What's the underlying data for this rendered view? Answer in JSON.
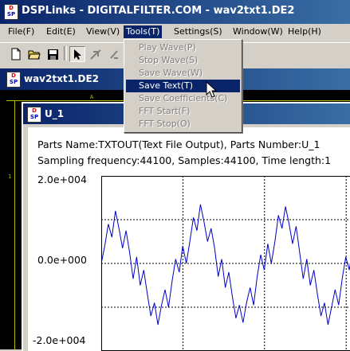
{
  "app": {
    "title": "DSPLinks - DIGITALFILTER.COM - wav2txt1.DE2",
    "icon_top": "D",
    "icon_bottom": "SP"
  },
  "menubar": {
    "items": [
      {
        "label": "File(F)",
        "active": false
      },
      {
        "label": "Edit(E)",
        "active": false
      },
      {
        "label": "View(V)",
        "active": false
      },
      {
        "label": "Tools(T)",
        "active": true
      },
      {
        "label": "Settings(S)",
        "active": false
      },
      {
        "label": "Window(W)",
        "active": false
      },
      {
        "label": "Help(H)",
        "active": false
      }
    ]
  },
  "toolbar": {
    "buttons": [
      "new-file-icon",
      "open-folder-icon",
      "save-disk-icon",
      "select-arrow-icon",
      "wire-tool-icon",
      "zoom-tool-icon"
    ]
  },
  "tools_menu": {
    "items": [
      {
        "label": "Play Wave(P)",
        "state": "disabled"
      },
      {
        "label": "Stop Wave(S)",
        "state": "disabled"
      },
      {
        "label": "Save Wave(W)",
        "state": "disabled"
      },
      {
        "label": "Save Text(T)",
        "state": "selected"
      },
      {
        "label": "Save Coefficients(C)",
        "state": "disabled"
      },
      {
        "label": "FFT Start(F)",
        "state": "disabled"
      },
      {
        "label": "FFT Stop(O)",
        "state": "disabled"
      }
    ]
  },
  "document": {
    "title": "wav2txt1.DE2",
    "ruler_marks": {
      "top": "A",
      "left": "1"
    }
  },
  "inner_window": {
    "title": "U_1",
    "info_line1": "Parts Name:TXTOUT(Text File Output), Parts Number:U_1",
    "info_line2": "Sampling frequency:44100, Samples:44100, Time length:1"
  },
  "chart_data": {
    "type": "line",
    "y_tick_labels": [
      "2.0e+004",
      "0.0e+000",
      "-2.0e+004"
    ],
    "ylim": [
      -20000,
      20000
    ],
    "grid": "dashed",
    "series": [
      {
        "color": "#0000c8",
        "values": [
          0,
          4000,
          9000,
          6000,
          12000,
          8000,
          3500,
          7500,
          2500,
          -3500,
          1500,
          -5000,
          -1500,
          -7000,
          -12000,
          -9000,
          -14000,
          -9500,
          -6000,
          -10000,
          -4000,
          1000,
          -2000,
          4000,
          0,
          5000,
          10500,
          7500,
          13500,
          9500,
          5000,
          8000,
          3500,
          -3000,
          1000,
          -5500,
          -2000,
          -7500,
          -12500,
          -9500,
          -13500,
          -9000,
          -5500,
          -9500,
          -3000,
          2000,
          -1500,
          4500,
          0,
          5000,
          11000,
          8000,
          13000,
          9000,
          4500,
          8500,
          2500,
          -3500,
          1000,
          -5000,
          -1500,
          -7000,
          -12000,
          -9000,
          -14000,
          -10000,
          -6000,
          -9500,
          -3500,
          1500,
          -1500,
          4000,
          0
        ]
      }
    ]
  }
}
